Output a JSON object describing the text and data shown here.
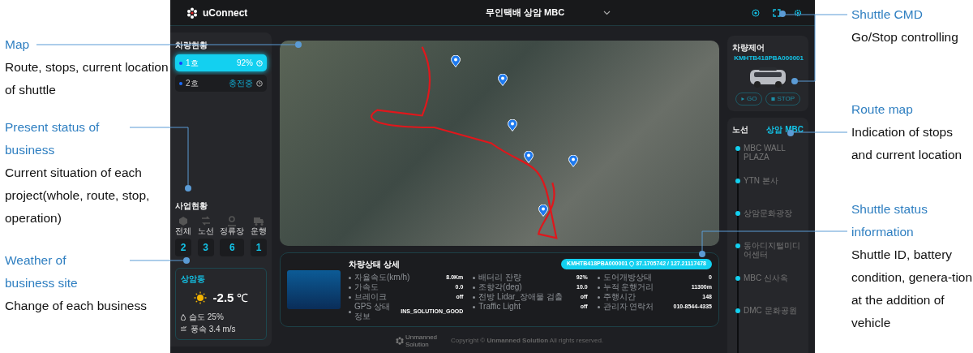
{
  "annotations_left": [
    {
      "title": "Map",
      "description": "Route, stops, current location of shuttle"
    },
    {
      "title": "Present status of business",
      "description": "Current situation of each project(whole, route, stop, operation)"
    },
    {
      "title": "Weather of business site",
      "description": "Change of each business"
    }
  ],
  "annotations_right": [
    {
      "title": "Shuttle CMD",
      "description": "Go/Stop controlling"
    },
    {
      "title": "Route map",
      "description": "Indication of stops and current location"
    },
    {
      "title": "Shuttle status information",
      "description": "Shuttle ID, battery condition, genera-tion at the addition of vehicle"
    }
  ],
  "header": {
    "logo": "uConnect",
    "site": "무인택배 상암 MBC"
  },
  "sidebar": {
    "vehicles_title": "차량현황",
    "vehicles": [
      {
        "name": "1호",
        "status": "92%",
        "selected": true
      },
      {
        "name": "2호",
        "status": "충전중",
        "selected": false
      }
    ],
    "business_title": "사업현황",
    "business": [
      {
        "kind": "all",
        "label": "전체",
        "count": "2"
      },
      {
        "kind": "route",
        "label": "노선",
        "count": "3"
      },
      {
        "kind": "stop",
        "label": "정류장",
        "count": "6"
      },
      {
        "kind": "operation",
        "label": "운행",
        "count": "1"
      }
    ],
    "weather": {
      "location": "상암동",
      "temperature": "-2.5",
      "unit": "℃",
      "humidity": "습도 25%",
      "wind": "풍속 3.4 m/s"
    }
  },
  "detail": {
    "title": "차량상태 상세",
    "vehicle_id": "KMHTB418PBA000001",
    "coords": "37.1705742 / 127.21117478",
    "columns": [
      [
        {
          "label": "자율속도(km/h)",
          "value": "8.0Km"
        },
        {
          "label": "가속도",
          "value": "0.0"
        },
        {
          "label": "브레이크",
          "value": "off"
        },
        {
          "label": "GPS 상태정보",
          "value": "INS_SOLUTION_GOOD"
        }
      ],
      [
        {
          "label": "배터리 잔량",
          "value": "92%"
        },
        {
          "label": "조향각(deg)",
          "value": "10.0"
        },
        {
          "label": "전방 Lidar_장애물 검출",
          "value": "off"
        },
        {
          "label": "Traffic Light",
          "value": "off"
        }
      ],
      [
        {
          "label": "도어개방상태",
          "value": "0"
        },
        {
          "label": "누적 운행거리",
          "value": "11300m"
        },
        {
          "label": "주행시간",
          "value": "148"
        },
        {
          "label": "관리자 연락처",
          "value": "010-8544-4335"
        }
      ]
    ]
  },
  "control": {
    "title": "차량제어",
    "vehicle_id": "KMHTB418PBA000001",
    "buttons": [
      {
        "kind": "go",
        "label": "GO"
      },
      {
        "kind": "stop",
        "label": "STOP"
      }
    ]
  },
  "route": {
    "title": "노선",
    "name": "상암 MBC",
    "stops": [
      "MBC WALL PLAZA",
      "YTN 본사",
      "상암문화광장",
      "동아디지털미디어센터",
      "MBC 신사옥",
      "DMC 문화공원"
    ]
  },
  "footer": {
    "company": "Unmanned Solution",
    "copyright": "Copyright © **Unmanned Solution** All rights reserved."
  }
}
